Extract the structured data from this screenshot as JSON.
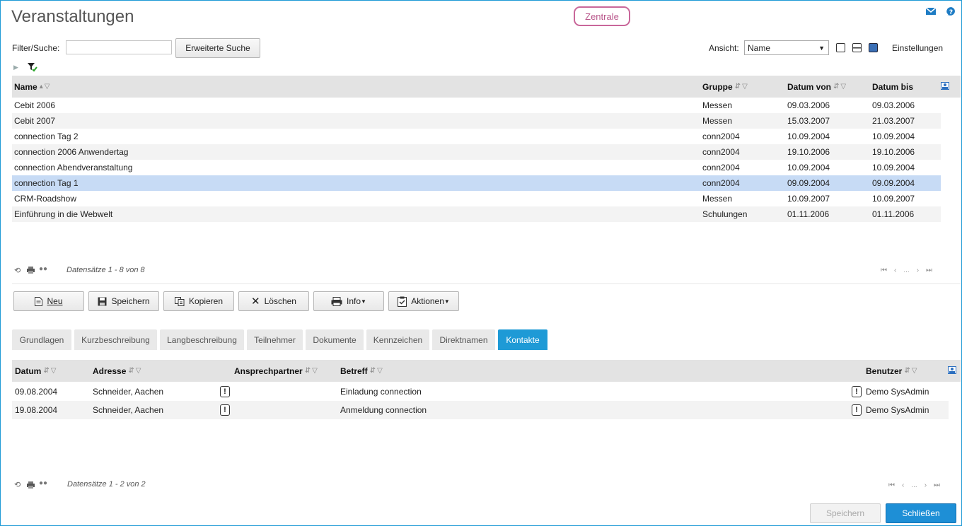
{
  "page": {
    "title": "Veranstaltungen",
    "badge": "Zentrale"
  },
  "filter": {
    "label": "Filter/Suche:",
    "value": "",
    "advanced_search": "Erweiterte Suche"
  },
  "view": {
    "label": "Ansicht:",
    "selected": "Name",
    "settings": "Einstellungen"
  },
  "events_grid": {
    "columns": [
      "Name",
      "Gruppe",
      "Datum von",
      "Datum bis"
    ],
    "rows": [
      {
        "name": "Cebit 2006",
        "group": "Messen",
        "from": "09.03.2006",
        "to": "09.03.2006"
      },
      {
        "name": "Cebit 2007",
        "group": "Messen",
        "from": "15.03.2007",
        "to": "21.03.2007"
      },
      {
        "name": "connection Tag 2",
        "group": "conn2004",
        "from": "10.09.2004",
        "to": "10.09.2004"
      },
      {
        "name": "connection 2006 Anwendertag",
        "group": "conn2004",
        "from": "19.10.2006",
        "to": "19.10.2006"
      },
      {
        "name": "connection Abendveranstaltung",
        "group": "conn2004",
        "from": "10.09.2004",
        "to": "10.09.2004"
      },
      {
        "name": "connection Tag 1",
        "group": "conn2004",
        "from": "09.09.2004",
        "to": "09.09.2004"
      },
      {
        "name": "CRM-Roadshow",
        "group": "Messen",
        "from": "10.09.2007",
        "to": "10.09.2007"
      },
      {
        "name": "Einführung in die Webwelt",
        "group": "Schulungen",
        "from": "01.11.2006",
        "to": "01.11.2006"
      }
    ],
    "selected_index": 5,
    "records": "Datensätze 1 - 8 von 8",
    "pager_ellipsis": "..."
  },
  "toolbar": {
    "new": "Neu",
    "save": "Speichern",
    "copy": "Kopieren",
    "delete": "Löschen",
    "info": "Info",
    "actions": "Aktionen"
  },
  "tabs": [
    "Grundlagen",
    "Kurzbeschreibung",
    "Langbeschreibung",
    "Teilnehmer",
    "Dokumente",
    "Kennzeichen",
    "Direktnamen",
    "Kontakte"
  ],
  "active_tab": "Kontakte",
  "contacts_grid": {
    "columns": [
      "Datum",
      "Adresse",
      "Ansprechpartner",
      "Betreff",
      "Benutzer"
    ],
    "rows": [
      {
        "date": "09.08.2004",
        "address": "Schneider, Aachen",
        "subject": "Einladung connection",
        "user": "Demo SysAdmin"
      },
      {
        "date": "19.08.2004",
        "address": "Schneider, Aachen",
        "subject": "Anmeldung connection",
        "user": "Demo SysAdmin"
      }
    ],
    "exclamation": "!",
    "records": "Datensätze 1 - 2 von 2",
    "pager_ellipsis": "..."
  },
  "footer": {
    "save": "Speichern",
    "close": "Schließen"
  },
  "colors": {
    "accent": "#1e9ad6",
    "selected_row": "#c7dbf5",
    "badge": "#c9679a"
  }
}
